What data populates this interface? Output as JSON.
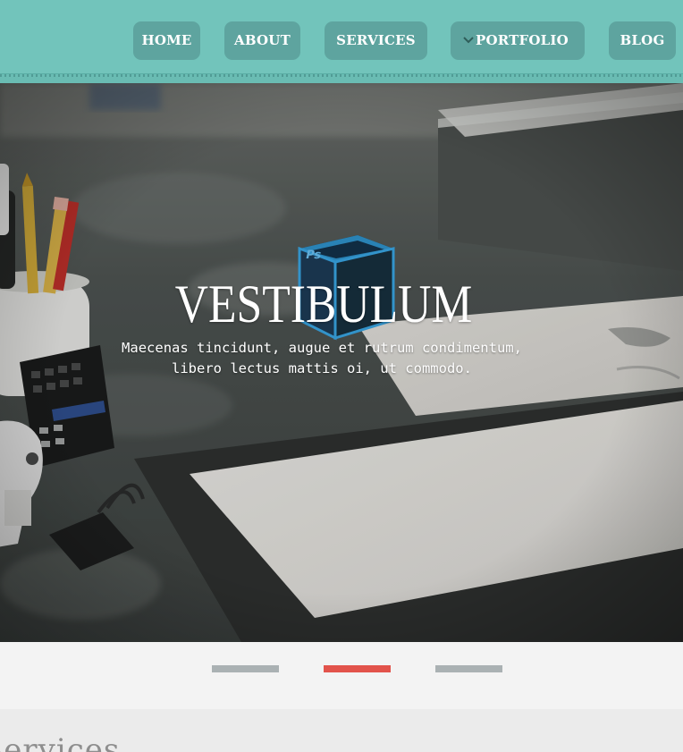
{
  "nav": {
    "items": [
      {
        "label": "HOME"
      },
      {
        "label": "ABOUT"
      },
      {
        "label": "SERVICES"
      },
      {
        "label": "PORTFOLIO",
        "icon": "chevron-down-icon"
      },
      {
        "label": "BLOG"
      }
    ]
  },
  "hero": {
    "title": "VESTIBULUM",
    "subtitle_line1": "Maecenas tincidunt, augue et rutrum condimentum,",
    "subtitle_line2": "libero lectus mattis oi, ut commodo."
  },
  "slider": {
    "count": 3,
    "active_index": 1
  },
  "services": {
    "title": "Services"
  },
  "colors": {
    "header": "#72c4bb",
    "nav_button": "#5ea49f",
    "indicator_active": "#e2534b",
    "indicator_inactive": "#aab1b3"
  }
}
